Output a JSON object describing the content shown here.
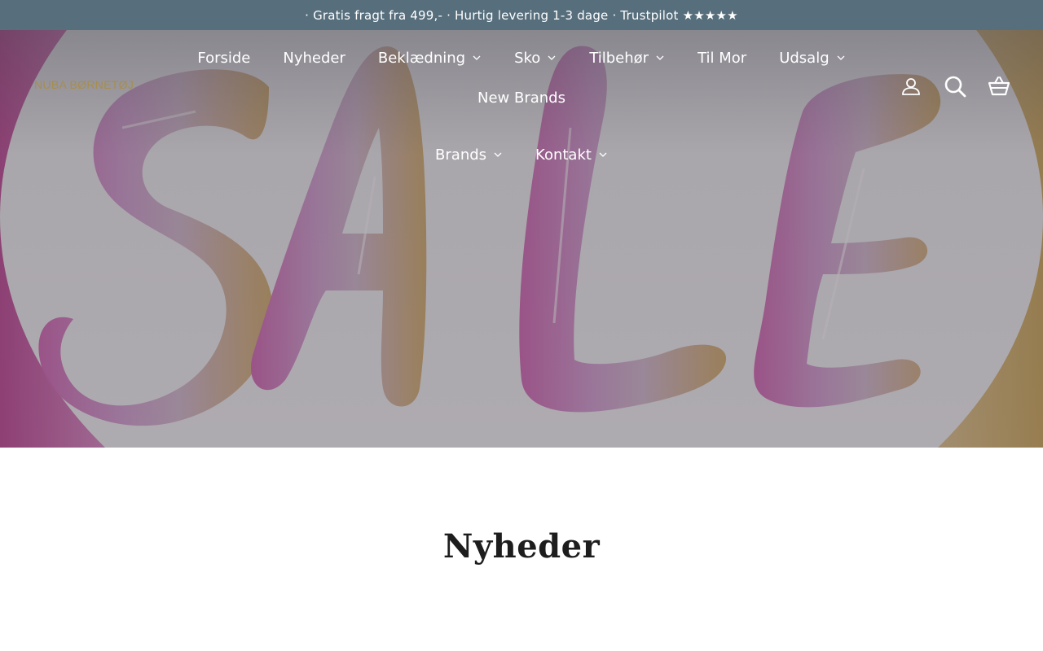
{
  "announcement": {
    "text": "· Gratis fragt fra 499,- · Hurtig levering 1-3 dage · Trustpilot ★★★★★"
  },
  "header": {
    "logo_text": "NUBA BØRNETØJ",
    "nav": [
      {
        "label": "Forside",
        "has_dropdown": false
      },
      {
        "label": "Nyheder",
        "has_dropdown": false
      },
      {
        "label": "Beklædning",
        "has_dropdown": true
      },
      {
        "label": "Sko",
        "has_dropdown": true
      },
      {
        "label": "Tilbehør",
        "has_dropdown": true
      },
      {
        "label": "Til Mor",
        "has_dropdown": false
      },
      {
        "label": "Udsalg",
        "has_dropdown": true
      },
      {
        "label": "New Brands",
        "has_dropdown": false
      },
      {
        "label": "Brands",
        "has_dropdown": true
      },
      {
        "label": "Kontakt",
        "has_dropdown": true
      }
    ],
    "icons": [
      "account-icon",
      "search-icon",
      "cart-icon"
    ]
  },
  "hero": {
    "image_text": "SALE"
  },
  "main": {
    "title": "Nyheder"
  },
  "colors": {
    "announcement_bg": "#576e7c",
    "logo": "#a78e4e",
    "nav_text": "#ffffff",
    "title": "#1d1d1d"
  }
}
